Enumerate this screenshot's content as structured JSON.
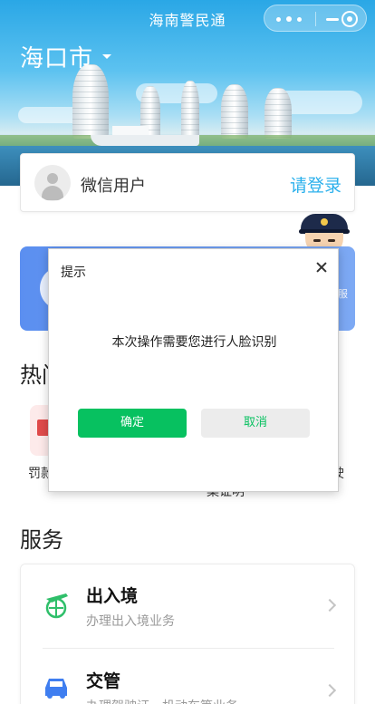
{
  "nav": {
    "title": "海南警民通"
  },
  "header": {
    "city": "海口市"
  },
  "user": {
    "name": "微信用户",
    "login_label": "请登录"
  },
  "sections": {
    "hot_title_visible": "热门",
    "service_title": "服务"
  },
  "hot_items": {
    "item1_label": "罚款",
    "item2_label": "驶",
    "item3_label": "案证明"
  },
  "services": [
    {
      "title": "出入境",
      "desc": "办理出入境业务",
      "icon": "plane-globe-icon"
    },
    {
      "title": "交管",
      "desc": "办理驾驶证、机动车等业务",
      "icon": "car-icon"
    }
  ],
  "blue_card": {
    "peek_text": "服"
  },
  "dialog": {
    "title": "提示",
    "message": "本次操作需要您进行人脸识别",
    "confirm_label": "确定",
    "cancel_label": "取消"
  },
  "colors": {
    "primary_green": "#07c160",
    "link_blue": "#2bb0ec",
    "card_blue": "#5b8ff0"
  }
}
